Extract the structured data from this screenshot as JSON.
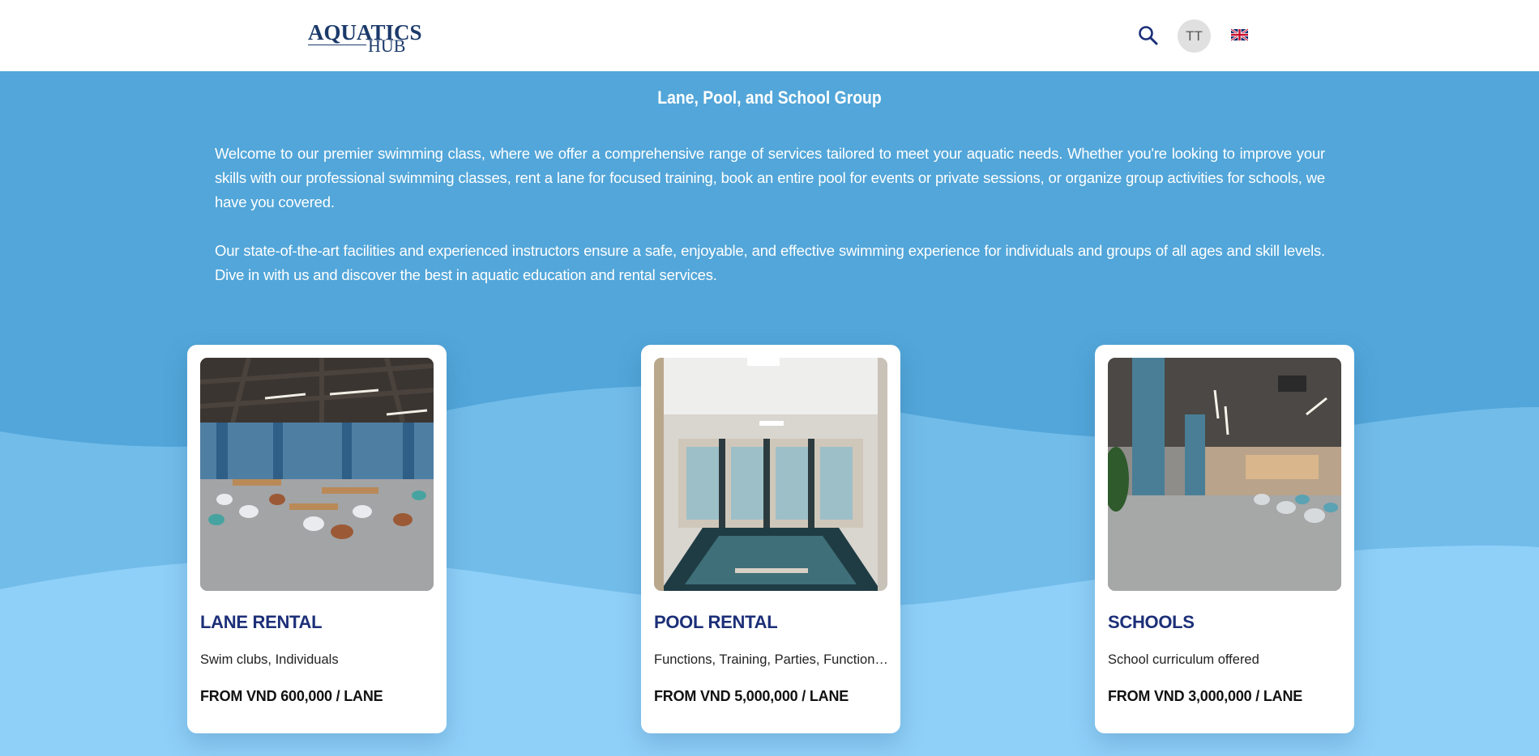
{
  "header": {
    "logo_top": "AQUATICS",
    "logo_bottom": "HUB",
    "avatar_initials": "TT",
    "search_icon": "search-icon",
    "language_icon": "uk-flag-icon"
  },
  "main": {
    "title": "Lane, Pool, and School Group",
    "paragraph1": "Welcome to our premier swimming class, where we offer a comprehensive range of services tailored to meet your aquatic needs. Whether you're looking to improve your skills with our professional swimming classes, rent a lane for focused training, book an entire pool for events or private sessions, or organize group activities for schools, we have you covered.",
    "paragraph2": "Our state-of-the-art facilities and experienced instructors ensure a safe, enjoyable, and effective swimming experience for individuals and groups of all ages and skill levels. Dive in with us and discover the best in aquatic education and rental services."
  },
  "cards": [
    {
      "name": "LANE RENTAL",
      "desc": "Swim clubs, Individuals",
      "price": "FROM VND 600,000 / LANE"
    },
    {
      "name": "POOL RENTAL",
      "desc": "Functions, Training, Parties, Functions, Events",
      "price": "FROM VND 5,000,000 / LANE"
    },
    {
      "name": "SCHOOLS",
      "desc": "School curriculum offered",
      "price": "FROM VND 3,000,000 / LANE"
    }
  ],
  "colors": {
    "background_top": "#52a6d9",
    "wave_mid": "#72bcea",
    "wave_bottom": "#8fd0f8",
    "card_title": "#1c2f78"
  }
}
